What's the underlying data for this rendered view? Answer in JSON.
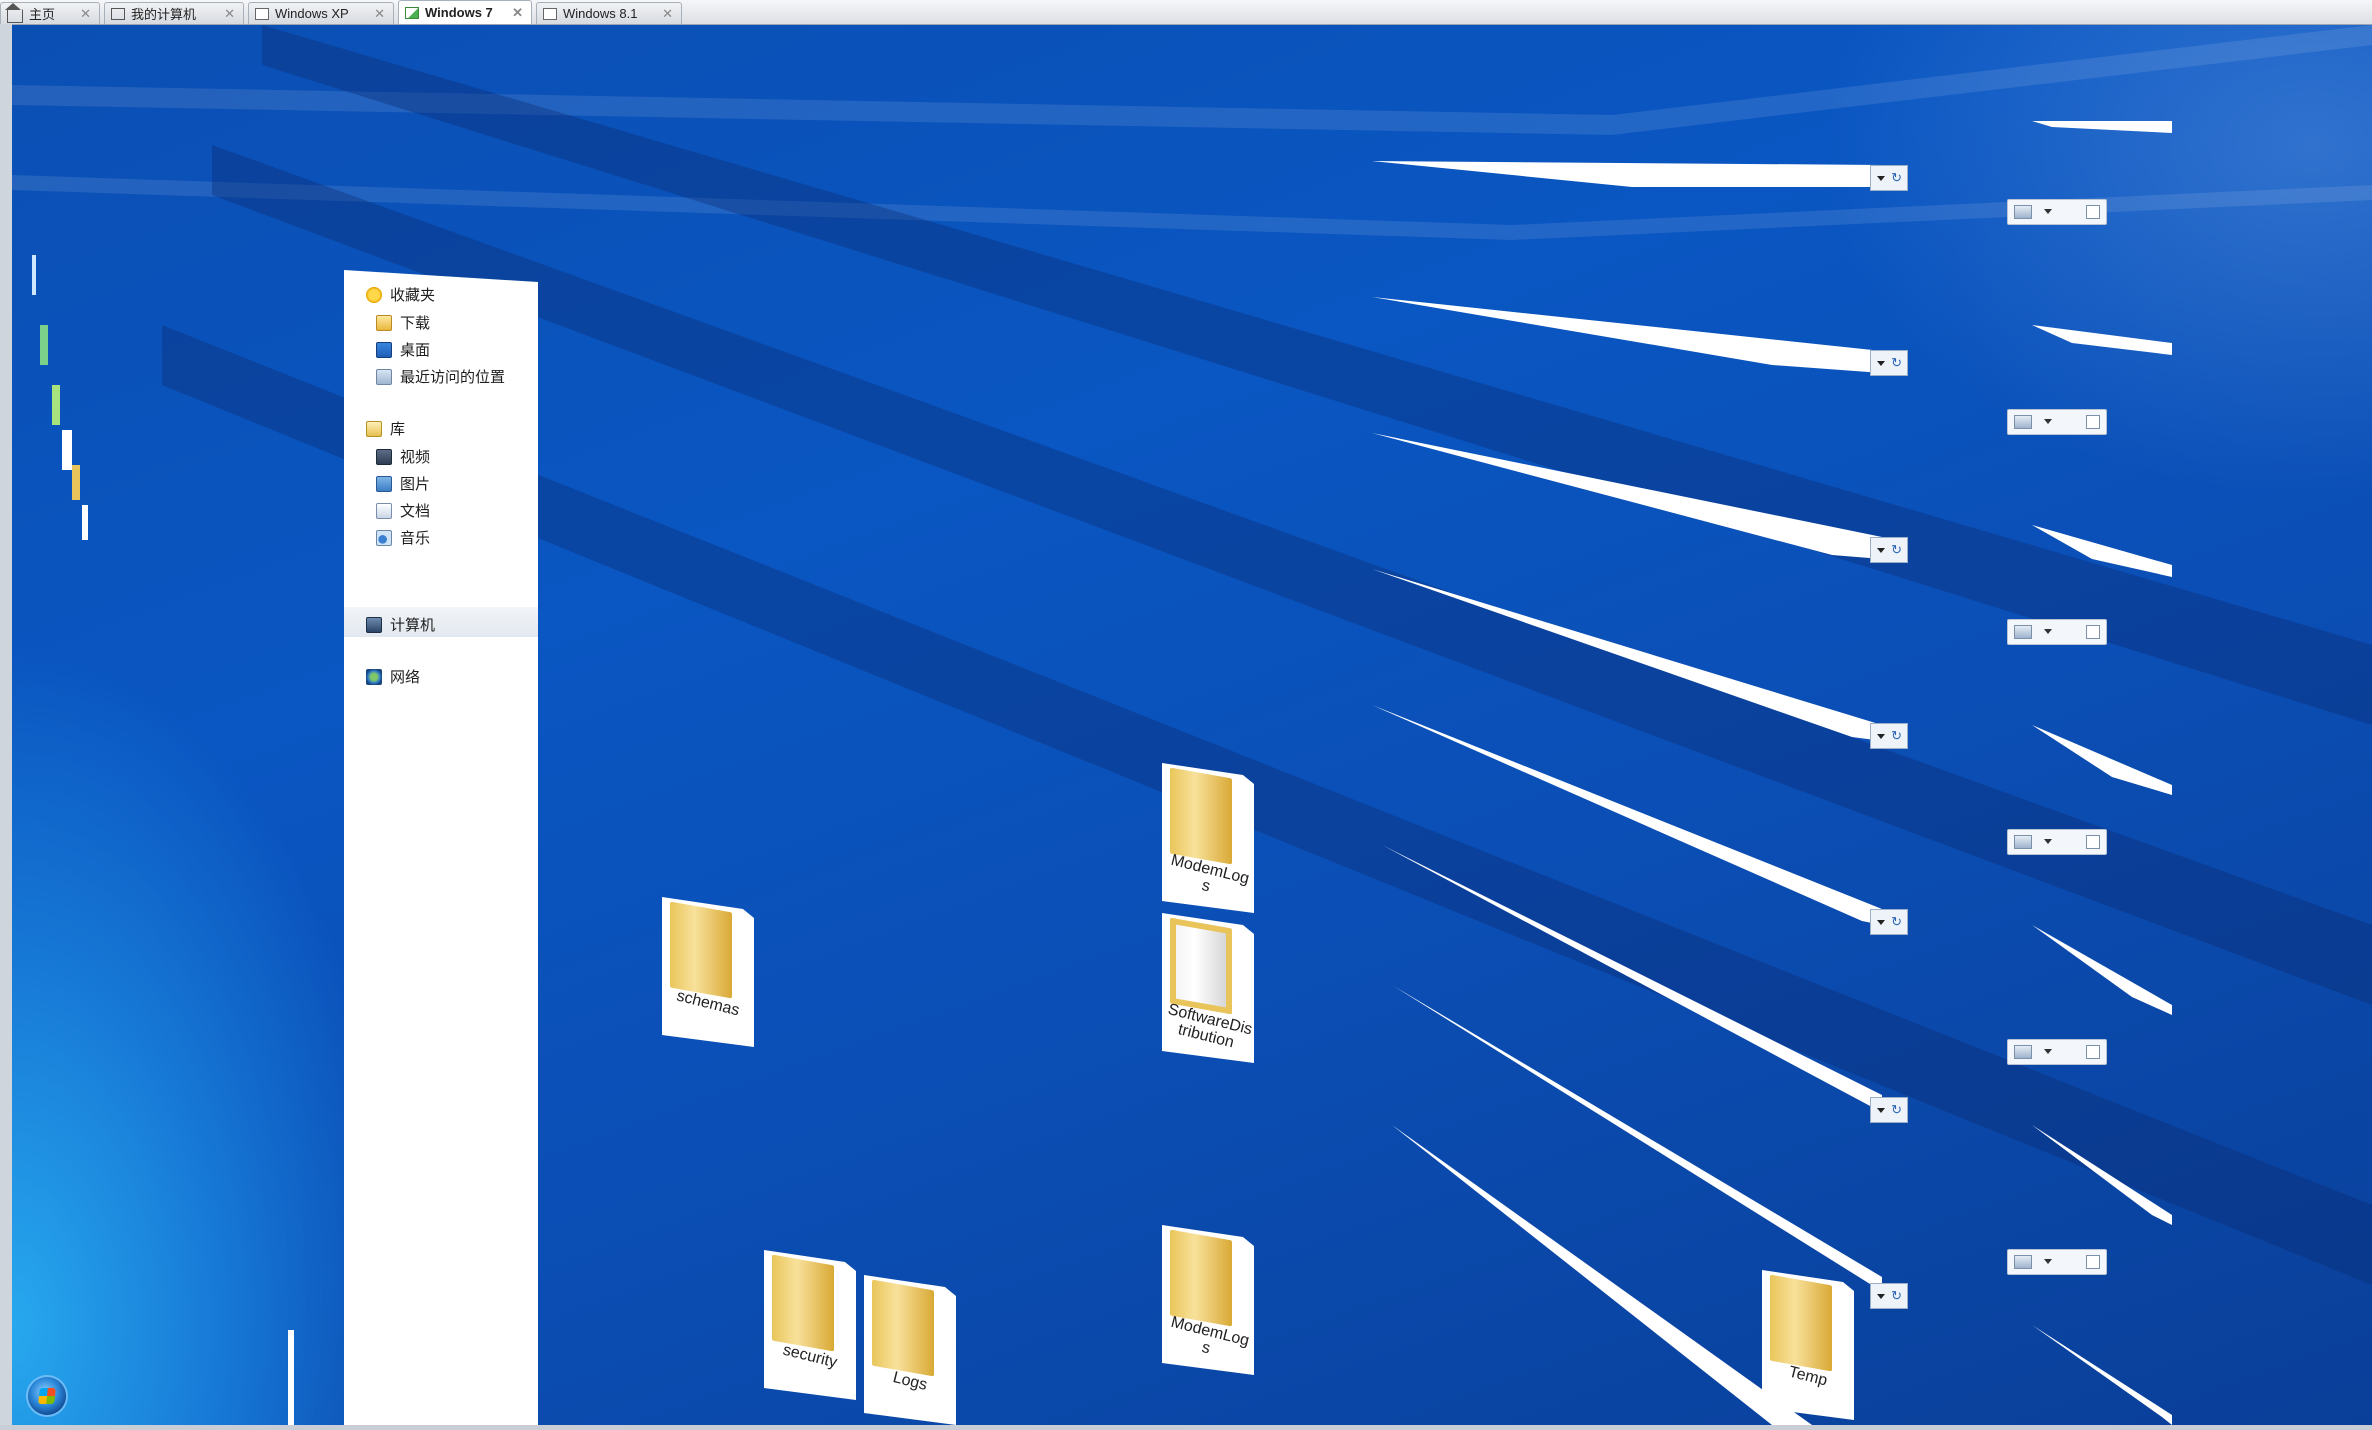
{
  "tabs": [
    {
      "label": "主页",
      "icon": "home-icon",
      "active": false
    },
    {
      "label": "我的计算机",
      "icon": "monitor-icon",
      "active": false
    },
    {
      "label": "Windows XP",
      "icon": "vm-icon",
      "active": false
    },
    {
      "label": "Windows 7",
      "icon": "vm-running-icon",
      "active": true
    },
    {
      "label": "Windows 8.1",
      "icon": "vm-icon",
      "active": false
    }
  ],
  "nav": {
    "favorites": "收藏夹",
    "downloads": "下载",
    "desktop": "桌面",
    "recent": "最近访问的位置",
    "libraries": "库",
    "videos": "视频",
    "pictures": "图片",
    "documents": "文档",
    "music": "音乐",
    "computer": "计算机",
    "network": "网络"
  },
  "folders": {
    "modemlogs_1": "ModemLogs",
    "softwaredistribution": "SoftwareDistribution",
    "schemas": "schemas",
    "security": "security",
    "logs": "Logs",
    "modemlogs_2": "ModemLogs",
    "temp": "Temp"
  },
  "theme": {
    "desktop_blue": "#0b4fb3",
    "tab_active_bg": "#ffffff"
  }
}
